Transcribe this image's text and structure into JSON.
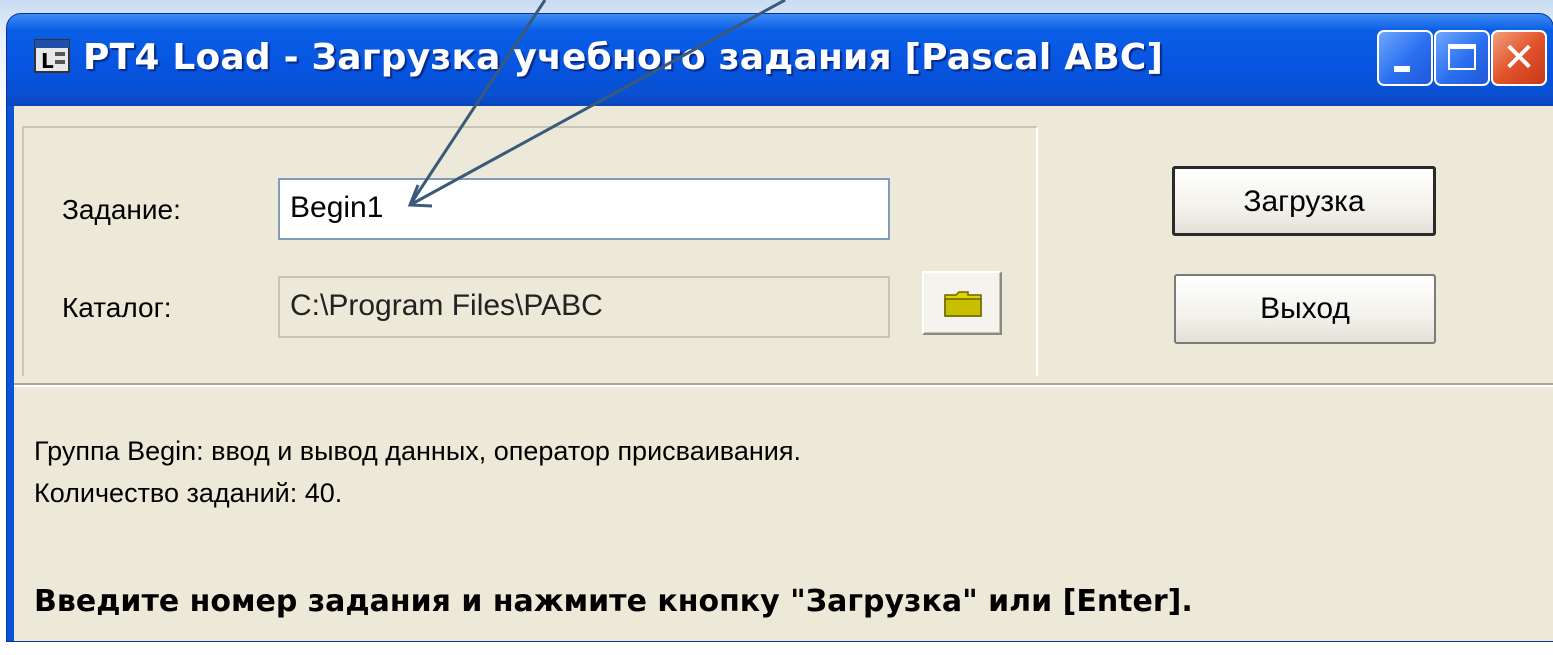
{
  "window": {
    "title": "PT4 Load - Загрузка учебного задания [Pascal ABC]"
  },
  "form": {
    "task_label": "Задание:",
    "task_value": "Begin1",
    "folder_label": "Каталог:",
    "folder_value": "C:\\Program Files\\PABC"
  },
  "buttons": {
    "load_label": "Загрузка",
    "exit_label": "Выход"
  },
  "info": {
    "line1": "Группа Begin: ввод и вывод данных, оператор присваивания.",
    "line2": "Количество заданий: 40.",
    "hint": "Введите номер задания и нажмите кнопку \"Загрузка\" или [Enter]."
  },
  "colors": {
    "titlebar": "#0a54d8",
    "client_bg": "#ece9d8",
    "close_button": "#e2542b",
    "annotation_arrow": "#3b5a7a"
  },
  "icons": {
    "app": "pt4-app-icon",
    "folder": "folder-icon",
    "minimize": "minimize-icon",
    "maximize": "maximize-icon",
    "close": "close-icon"
  }
}
